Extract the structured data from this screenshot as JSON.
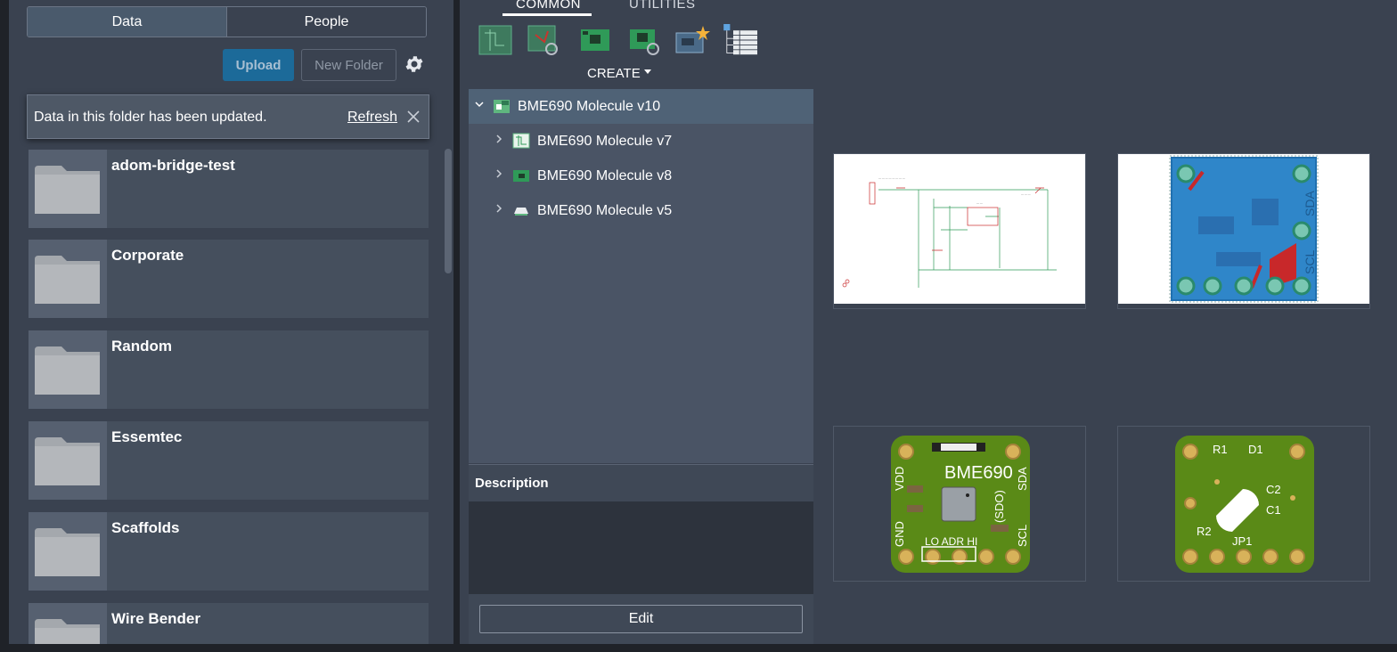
{
  "left_panel": {
    "tabs": {
      "data": "Data",
      "people": "People"
    },
    "upload_label": "Upload",
    "new_folder_label": "New Folder",
    "notice": {
      "message": "Data in this folder has been updated.",
      "refresh": "Refresh"
    },
    "folders": [
      {
        "name": "adom-bridge-test"
      },
      {
        "name": "Corporate"
      },
      {
        "name": "Random"
      },
      {
        "name": "Essemtec"
      },
      {
        "name": "Scaffolds"
      },
      {
        "name": "Wire Bender"
      }
    ]
  },
  "toolbar": {
    "tabs": {
      "common": "COMMON",
      "utilities": "UTILITIES"
    },
    "create_label": "CREATE",
    "tools": [
      "new-schematic-icon",
      "link-schematic-icon",
      "new-board-icon",
      "link-board-icon",
      "new-design-icon",
      "bom-table-icon"
    ]
  },
  "tree": {
    "items": [
      {
        "label": "BME690 Molecule v10",
        "icon": "electronics-design-icon"
      },
      {
        "label": "BME690 Molecule v7",
        "icon": "schematic-icon"
      },
      {
        "label": "BME690 Molecule v8",
        "icon": "pcb-board-icon"
      },
      {
        "label": "BME690 Molecule v5",
        "icon": "package-icon"
      }
    ]
  },
  "details": {
    "description_label": "Description",
    "edit_label": "Edit"
  },
  "previews": {
    "board_text": {
      "title": "BME690",
      "vdd": "VDD",
      "gnd": "GND",
      "sda": "SDA",
      "scl": "SCL",
      "sdo": "(SDO)",
      "addr": "LO ADR HI"
    },
    "board2_text": {
      "r1": "R1",
      "d1": "D1",
      "c2": "C2",
      "c1": "C1",
      "r2": "R2",
      "jp1": "JP1"
    },
    "board_layout_text": {
      "sda": "SDA",
      "scl": "SCL"
    },
    "colors": {
      "pcb_green": "#5a8a17",
      "pad_gold": "#d8b25a",
      "copper_blue": "#2f86c9",
      "trace_red": "#c8282a"
    }
  }
}
